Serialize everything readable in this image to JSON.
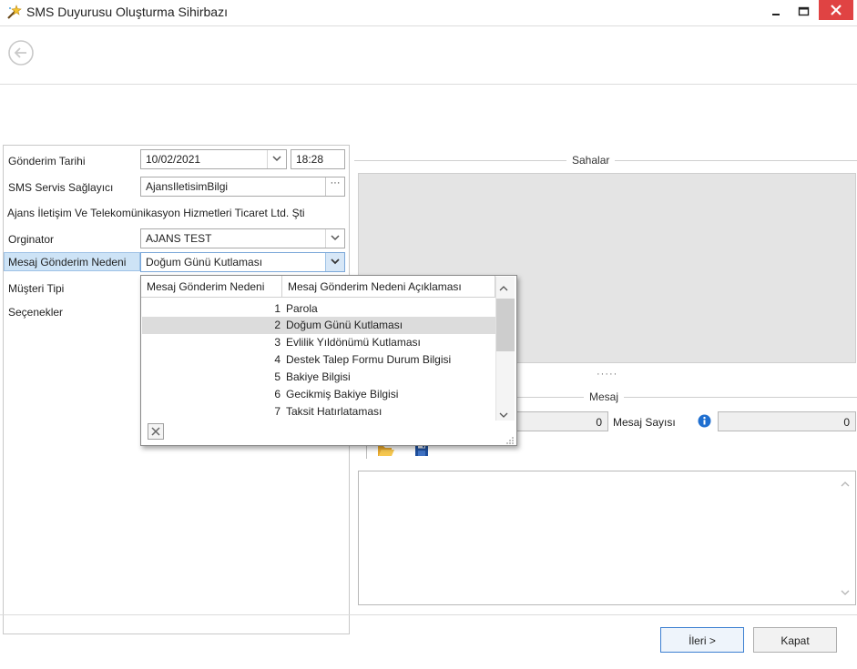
{
  "window": {
    "title": "SMS Duyurusu Oluşturma Sihirbazı",
    "app_icon": "wand-icon",
    "controls": [
      "minimize-icon",
      "maximize-icon",
      "close-icon"
    ],
    "close_color": "#e04343"
  },
  "toolbar": {
    "back_icon": "back-arrow-icon"
  },
  "form": {
    "gonderim_tarihi": {
      "label": "Gönderim Tarihi",
      "date": "10/02/2021",
      "time": "18:28"
    },
    "sms_servis": {
      "label": "SMS Servis Sağlayıcı",
      "value": "AjansIletisimBilgi",
      "button_label": "···"
    },
    "provider_description": "Ajans İletişim Ve Telekomünikasyon Hizmetleri Ticaret Ltd. Şti",
    "orginator": {
      "label": "Orginator",
      "value": "AJANS TEST"
    },
    "mesaj_gonderim_nedeni": {
      "label": "Mesaj Gönderim Nedeni",
      "value": "Doğum Günü Kutlaması"
    },
    "musteri_tipi": {
      "label": "Müşteri Tipi"
    },
    "secenekler": {
      "label": "Seçenekler"
    }
  },
  "dropdown": {
    "columns": [
      "Mesaj Gönderim Nedeni",
      "Mesaj Gönderim Nedeni Açıklaması"
    ],
    "rows": [
      {
        "num": "1",
        "text": "Parola"
      },
      {
        "num": "2",
        "text": "Doğum Günü Kutlaması",
        "selected": true
      },
      {
        "num": "3",
        "text": "Evlilik Yıldönümü Kutlaması"
      },
      {
        "num": "4",
        "text": "Destek Talep Formu Durum Bilgisi"
      },
      {
        "num": "5",
        "text": "Bakiye Bilgisi"
      },
      {
        "num": "6",
        "text": "Gecikmiş Bakiye Bilgisi"
      },
      {
        "num": "7",
        "text": "Taksit Hatırlataması"
      }
    ]
  },
  "right": {
    "sahalar_title": "Sahalar",
    "splitter": "·····",
    "mesaj_title": "Mesaj",
    "char_count": "0",
    "mesaj_sayisi_label": "Mesaj Sayısı",
    "mesaj_sayisi_value": "0",
    "info_icon": "info-icon",
    "folder_icon": "folder-open-icon",
    "save_icon": "save-icon"
  },
  "footer": {
    "next_label": "İleri >",
    "close_label": "Kapat"
  },
  "colors": {
    "selection_highlight": "#cde3f6",
    "selected_row": "#dcdcdc",
    "info_blue": "#1f6fd0"
  }
}
